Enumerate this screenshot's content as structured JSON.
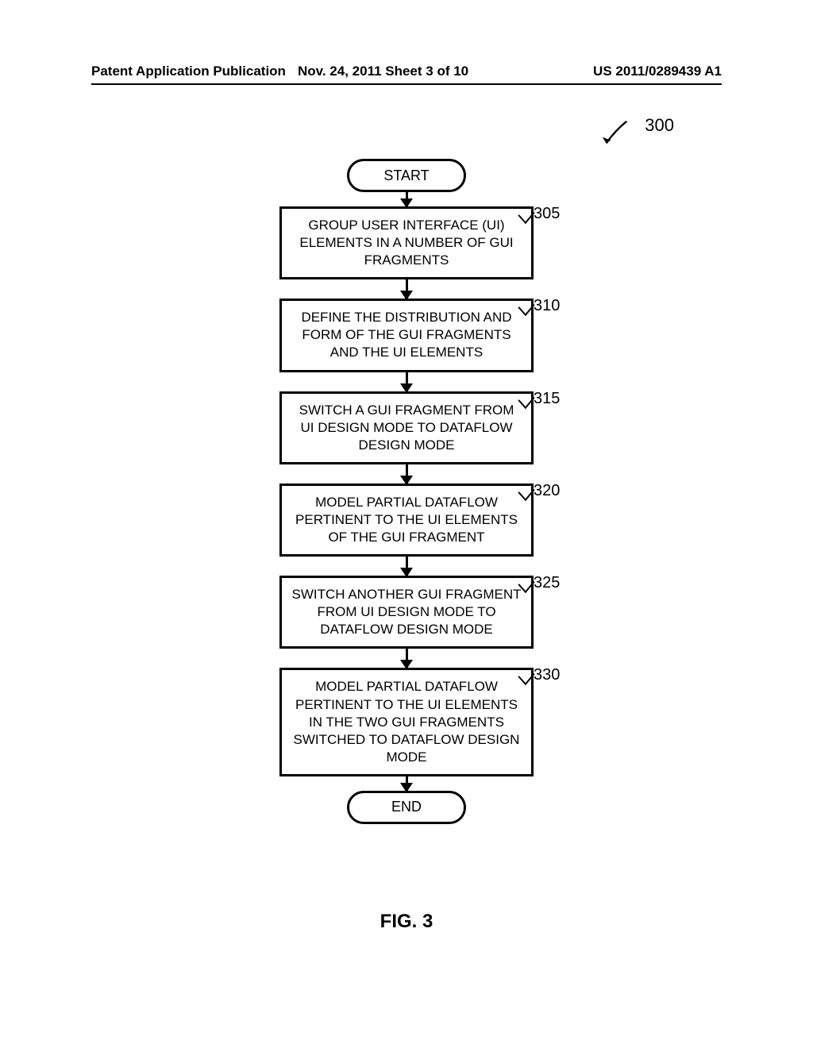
{
  "header": {
    "left": "Patent Application Publication",
    "center": "Nov. 24, 2011  Sheet 3 of 10",
    "right": "US 2011/0289439 A1"
  },
  "diagram": {
    "reference": "300",
    "start": "START",
    "end": "END",
    "figure_label": "FIG. 3",
    "steps": [
      {
        "ref": "305",
        "text": "GROUP USER INTERFACE (UI) ELEMENTS IN A NUMBER OF GUI FRAGMENTS"
      },
      {
        "ref": "310",
        "text": "DEFINE THE DISTRIBUTION AND FORM OF THE GUI FRAGMENTS AND THE UI ELEMENTS"
      },
      {
        "ref": "315",
        "text": "SWITCH A GUI FRAGMENT FROM UI DESIGN MODE TO DATAFLOW DESIGN MODE"
      },
      {
        "ref": "320",
        "text": "MODEL PARTIAL DATAFLOW PERTINENT TO THE UI ELEMENTS OF THE GUI FRAGMENT"
      },
      {
        "ref": "325",
        "text": "SWITCH ANOTHER GUI FRAGMENT FROM UI DESIGN MODE TO DATAFLOW DESIGN MODE"
      },
      {
        "ref": "330",
        "text": "MODEL PARTIAL DATAFLOW PERTINENT TO THE UI ELEMENTS IN THE TWO GUI FRAGMENTS SWITCHED TO DATAFLOW DESIGN MODE"
      }
    ]
  }
}
